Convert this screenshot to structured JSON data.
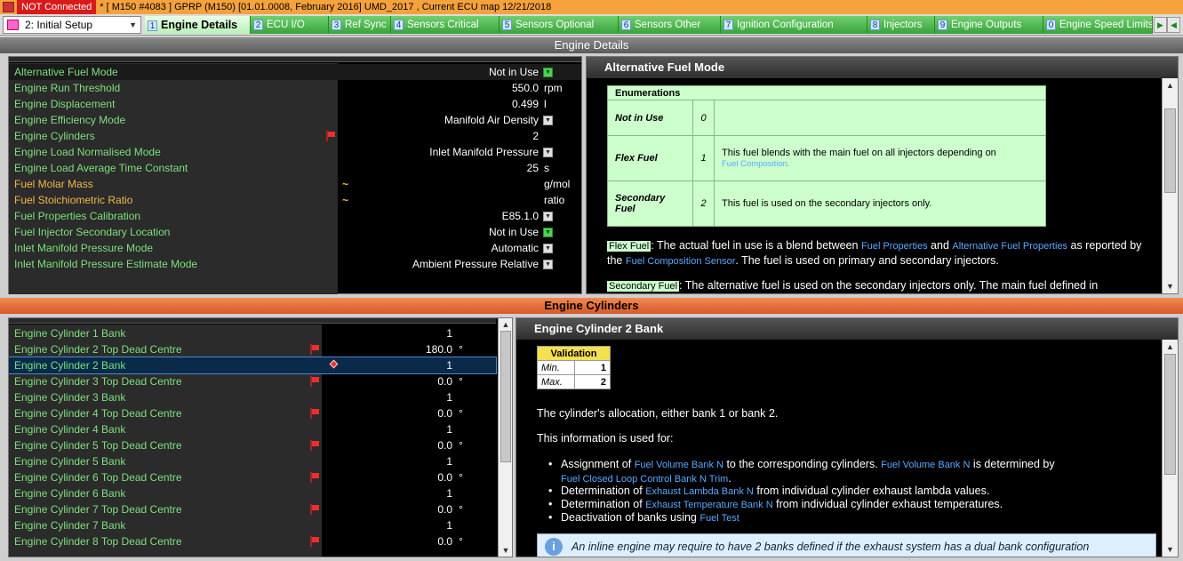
{
  "titlebar": {
    "status": "NOT Connected",
    "text": "* [ M150 #4083 ]  GPRP (M150) [01.01.0008, February 2016] UMD_2017 , Current ECU map 12/21/2018"
  },
  "setup_select": {
    "value": "2: Initial Setup"
  },
  "tabs": [
    {
      "num": "1",
      "label": "Engine Details"
    },
    {
      "num": "2",
      "label": "ECU I/O"
    },
    {
      "num": "3",
      "label": "Ref Sync"
    },
    {
      "num": "4",
      "label": "Sensors Critical"
    },
    {
      "num": "5",
      "label": "Sensors Optional"
    },
    {
      "num": "6",
      "label": "Sensors Other"
    },
    {
      "num": "7",
      "label": "Ignition Configuration"
    },
    {
      "num": "8",
      "label": "Injectors"
    },
    {
      "num": "9",
      "label": "Engine Outputs"
    },
    {
      "num": "0",
      "label": "Engine Speed Limits"
    }
  ],
  "section1": {
    "title": "Engine Details",
    "rows": [
      {
        "name": "Alternative Fuel Mode",
        "value": "Not in Use",
        "unit": "",
        "color": "green",
        "dd": "green",
        "flag": false,
        "tilde": false
      },
      {
        "name": "Engine Run Threshold",
        "value": "550.0",
        "unit": "rpm",
        "color": "green",
        "dd": "",
        "flag": false,
        "tilde": false
      },
      {
        "name": "Engine Displacement",
        "value": "0.499",
        "unit": "l",
        "color": "green",
        "dd": "",
        "flag": false,
        "tilde": false
      },
      {
        "name": "Engine Efficiency Mode",
        "value": "Manifold Air Density",
        "unit": "",
        "color": "green",
        "dd": "grey",
        "flag": false,
        "tilde": false
      },
      {
        "name": "Engine Cylinders",
        "value": "2",
        "unit": "",
        "color": "green",
        "dd": "",
        "flag": true,
        "tilde": false
      },
      {
        "name": "Engine Load Normalised Mode",
        "value": "Inlet Manifold Pressure",
        "unit": "",
        "color": "green",
        "dd": "grey",
        "flag": false,
        "tilde": false
      },
      {
        "name": "Engine Load Average Time Constant",
        "value": "25",
        "unit": "s",
        "color": "green",
        "dd": "",
        "flag": false,
        "tilde": false
      },
      {
        "name": "Fuel Molar Mass",
        "value": "",
        "unit": "g/mol",
        "color": "orange",
        "dd": "",
        "flag": false,
        "tilde": true
      },
      {
        "name": "Fuel Stoichiometric Ratio",
        "value": "",
        "unit": "ratio",
        "color": "orange",
        "dd": "",
        "flag": false,
        "tilde": true
      },
      {
        "name": "Fuel Properties Calibration",
        "value": "E85.1.0",
        "unit": "",
        "color": "green",
        "dd": "grey",
        "flag": false,
        "tilde": false
      },
      {
        "name": "Fuel Injector Secondary Location",
        "value": "Not in Use",
        "unit": "",
        "color": "green",
        "dd": "green",
        "flag": false,
        "tilde": false
      },
      {
        "name": "Inlet Manifold Pressure Mode",
        "value": "Automatic",
        "unit": "",
        "color": "green",
        "dd": "grey",
        "flag": false,
        "tilde": false
      },
      {
        "name": "Inlet Manifold Pressure Estimate Mode",
        "value": "Ambient Pressure Relative",
        "unit": "",
        "color": "green",
        "dd": "grey",
        "flag": false,
        "tilde": false
      }
    ]
  },
  "help1": {
    "title": "Alternative Fuel Mode",
    "enum_header": "Enumerations",
    "enums": [
      {
        "name": "Not in Use",
        "num": "0",
        "desc": "",
        "link": ""
      },
      {
        "name": "Flex Fuel",
        "num": "1",
        "desc": "This fuel blends with the main fuel on all injectors depending on",
        "link": "Fuel Composition."
      },
      {
        "name": "Secondary Fuel",
        "num": "2",
        "desc": "This fuel is used on the secondary injectors only.",
        "link": ""
      }
    ],
    "flex_tag": "Flex Fuel",
    "flex_p1": ": The actual fuel in use is a blend between ",
    "flex_l1": "Fuel Properties",
    "flex_p2": " and ",
    "flex_l2": "Alternative Fuel Properties",
    "flex_p3": " as reported by",
    "flex_p4": "the ",
    "flex_l3": "Fuel Composition Sensor",
    "flex_p5": ". The fuel is used on primary and secondary injectors.",
    "sec_tag": "Secondary Fuel",
    "sec_p1": ": The alternative fuel is used on the secondary injectors only. The main fuel defined in"
  },
  "section2": {
    "title": "Engine Cylinders",
    "rows": [
      {
        "name": "Engine Cylinder 1 Bank",
        "value": "1",
        "unit": "",
        "flag": false,
        "selected": false
      },
      {
        "name": "Engine Cylinder 2 Top Dead Centre",
        "value": "180.0",
        "unit": "°",
        "flag": true,
        "selected": false
      },
      {
        "name": "Engine Cylinder 2 Bank",
        "value": "1",
        "unit": "",
        "flag": false,
        "selected": true
      },
      {
        "name": "Engine Cylinder 3 Top Dead Centre",
        "value": "0.0",
        "unit": "°",
        "flag": true,
        "selected": false
      },
      {
        "name": "Engine Cylinder 3 Bank",
        "value": "1",
        "unit": "",
        "flag": false,
        "selected": false
      },
      {
        "name": "Engine Cylinder 4 Top Dead Centre",
        "value": "0.0",
        "unit": "°",
        "flag": true,
        "selected": false
      },
      {
        "name": "Engine Cylinder 4 Bank",
        "value": "1",
        "unit": "",
        "flag": false,
        "selected": false
      },
      {
        "name": "Engine Cylinder 5 Top Dead Centre",
        "value": "0.0",
        "unit": "°",
        "flag": true,
        "selected": false
      },
      {
        "name": "Engine Cylinder 5 Bank",
        "value": "1",
        "unit": "",
        "flag": false,
        "selected": false
      },
      {
        "name": "Engine Cylinder 6 Top Dead Centre",
        "value": "0.0",
        "unit": "°",
        "flag": true,
        "selected": false
      },
      {
        "name": "Engine Cylinder 6 Bank",
        "value": "1",
        "unit": "",
        "flag": false,
        "selected": false
      },
      {
        "name": "Engine Cylinder 7 Top Dead Centre",
        "value": "0.0",
        "unit": "°",
        "flag": true,
        "selected": false
      },
      {
        "name": "Engine Cylinder 7 Bank",
        "value": "1",
        "unit": "",
        "flag": false,
        "selected": false
      },
      {
        "name": "Engine Cylinder 8 Top Dead Centre",
        "value": "0.0",
        "unit": "°",
        "flag": true,
        "selected": false
      }
    ]
  },
  "help2": {
    "title": "Engine Cylinder 2 Bank",
    "validation_header": "Validation",
    "min_label": "Min.",
    "min_value": "1",
    "max_label": "Max.",
    "max_value": "2",
    "p1": "The cylinder's allocation, either bank 1 or bank 2.",
    "p2": "This information is used for:",
    "b1_a": "Assignment of ",
    "b1_l1": "Fuel Volume Bank N",
    "b1_b": " to the corresponding cylinders. ",
    "b1_l2": "Fuel Volume Bank N",
    "b1_c": " is determined by",
    "b1_l3": "Fuel Closed Loop Control Bank N Trim",
    "b1_d": ".",
    "b2_a": "Determination of ",
    "b2_l": "Exhaust Lambda Bank N",
    "b2_b": " from individual cylinder exhaust lambda values.",
    "b3_a": "Determination of ",
    "b3_l": "Exhaust Temperature Bank N",
    "b3_b": " from individual cylinder exhaust temperatures.",
    "b4_a": "Deactivation of banks using ",
    "b4_l": "Fuel Test",
    "info": "An inline engine may require to have 2 banks defined if the exhaust system has a dual bank configuration"
  }
}
